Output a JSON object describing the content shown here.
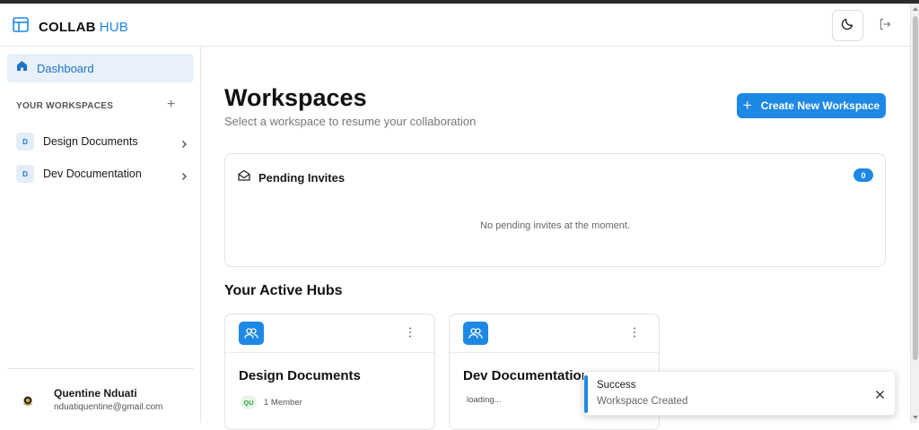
{
  "header": {
    "logo_bold": "COLLAB",
    "logo_light": "HUB",
    "theme_icon": "moon-icon",
    "logout_icon": "logout-icon"
  },
  "sidebar": {
    "dashboard_label": "Dashboard",
    "workspaces_heading": "YOUR WORKSPACES",
    "add_symbol": "+",
    "workspaces": [
      {
        "initial": "D",
        "label": "Design Documents"
      },
      {
        "initial": "D",
        "label": "Dev Documentation"
      }
    ],
    "user": {
      "name": "Quentine Nduati",
      "email": "nduatiquentine@gmail.com"
    }
  },
  "main": {
    "title": "Workspaces",
    "subtitle": "Select a workspace to resume your collaboration",
    "create_button": "Create New Workspace",
    "create_plus": "+",
    "invites": {
      "title": "Pending Invites",
      "count": "0",
      "empty_text": "No pending invites at the moment."
    },
    "hubs_title": "Your Active Hubs",
    "hubs": [
      {
        "name": "Design Documents",
        "member_initials": "QU",
        "member_text": "1 Member"
      },
      {
        "name": "Dev Documentation",
        "status_text": "loading..."
      }
    ]
  },
  "toast": {
    "title": "Success",
    "message": "Workspace Created"
  },
  "colors": {
    "accent": "#1e88e5",
    "active_nav_bg": "#e8f1fb",
    "member_badge_bg": "#e7f5e8",
    "member_badge_text": "#3aa24a"
  }
}
